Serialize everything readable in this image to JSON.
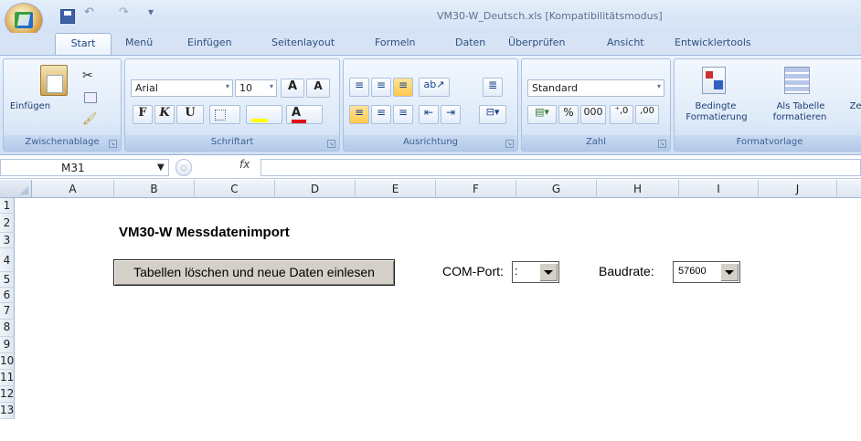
{
  "window": {
    "title": "VM30-W_Deutsch.xls [Kompatibilitätsmodus]"
  },
  "qat": {
    "undo_icon": "↶",
    "redo_icon": "↷",
    "menu_icon": "▾"
  },
  "tabs": [
    "Start",
    "Menü",
    "Einfügen",
    "Seitenlayout",
    "Formeln",
    "Daten",
    "Überprüfen",
    "Ansicht",
    "Entwicklertools"
  ],
  "ribbon": {
    "clipboard": {
      "paste_label": "Einfügen",
      "group_label": "Zwischenablage"
    },
    "font": {
      "font_name": "Arial",
      "font_size": "10",
      "group_label": "Schriftart",
      "bold": "F",
      "italic": "K",
      "underline": "U",
      "grow": "A",
      "shrink": "A"
    },
    "alignment": {
      "group_label": "Ausrichtung"
    },
    "number": {
      "format": "Standard",
      "group_label": "Zahl",
      "percent": "%",
      "thousands": "000",
      "inc_decimal": "⁺,0",
      "dec_decimal": ",00"
    },
    "styles": {
      "conditional_label_1": "Bedingte",
      "conditional_label_2": "Formatierung",
      "table_label_1": "Als Tabelle",
      "table_label_2": "formatieren",
      "partial_label": "Ze",
      "group_label": "Formatvorlage"
    }
  },
  "formula_bar": {
    "name_box": "M31",
    "fx_label": "fx",
    "value": ""
  },
  "columns": [
    "A",
    "B",
    "C",
    "D",
    "E",
    "F",
    "G",
    "H",
    "I",
    "J"
  ],
  "rows": [
    "1",
    "2",
    "3",
    "4",
    "5",
    "6",
    "7",
    "8",
    "9",
    "10",
    "11",
    "12",
    "13"
  ],
  "sheet": {
    "heading": "VM30-W  Messdatenimport",
    "import_button": "Tabellen löschen und neue Daten einlesen",
    "com_label": "COM-Port:",
    "com_value": ":",
    "baud_label": "Baudrate:",
    "baud_value": "57600"
  }
}
